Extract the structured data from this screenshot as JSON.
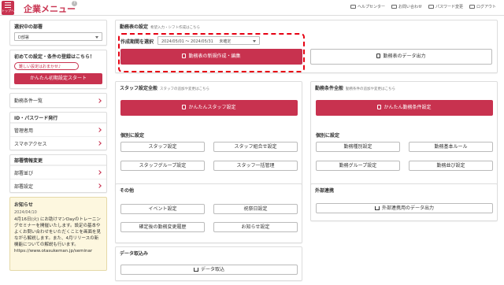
{
  "header": {
    "menu_label": "トップへ",
    "title": "企業メニュー",
    "help_mark": "?",
    "links": [
      {
        "icon": "book-icon",
        "label": "ヘルプセンター"
      },
      {
        "icon": "mail-icon",
        "label": "お問い合わせ"
      },
      {
        "icon": "key-icon",
        "label": "パスワード変更"
      },
      {
        "icon": "logout-icon",
        "label": "ログアウト"
      }
    ]
  },
  "sidebar": {
    "dept_title": "選択中の部署",
    "dept_value": "D部署",
    "setup_title": "初めての設定・条件の登録はこちら！",
    "setup_bubble": "難しい設定はおまかせ♪",
    "setup_button": "かんたん初期設定スタート",
    "work_conditions": "勤務条件一覧",
    "id_password_title": "ID・パスワード発行",
    "id_items": [
      "管理者用",
      "スマホアクセス"
    ],
    "dept_info_title": "部署情報変更",
    "dept_items": [
      "部署並び",
      "部署設定"
    ],
    "notice": {
      "title": "お知らせ",
      "date": "2024/04/10",
      "text": "4月16日(火) にお助けマンDayのトレーニングセミナーを開催いたします。設定の基本やよくお問い合わせをいただくことを画面を見ながら解説します。また、4月リリースの新機能についての解説も行います。",
      "url": "https://www.otasukeman.jp/seminar"
    }
  },
  "schedule": {
    "title": "勤務表の設定",
    "subtitle": "希望入力・シフト作成はこちら",
    "period_label": "作成期間を選択",
    "period_value": "2024/05/01 ～ 2024/05/31",
    "period_status": "未確定",
    "create_button": "勤務表の新規作成・編集",
    "export_button": "勤務表のデータ出力"
  },
  "staff": {
    "title": "スタッフ設定全般",
    "subtitle": "スタッフの追加や変更はこちら",
    "easy_button": "かんたんスタッフ設定",
    "individual_label": "個別に設定",
    "buttons": [
      "スタッフ設定",
      "スタッフ組合せ設定",
      "スタッフグループ設定",
      "スタッフ一括管理"
    ]
  },
  "conditions": {
    "title": "勤務条件全般",
    "subtitle": "勤務条件の追加や変更はこちら",
    "easy_button": "かんたん勤務条件設定",
    "individual_label": "個別に設定",
    "buttons": [
      "勤務種別設定",
      "勤務基本ルール",
      "勤務グループ設定",
      "勤務並び設定"
    ]
  },
  "other": {
    "title": "その他",
    "buttons": [
      "イベント設定",
      "祝祭日設定",
      "確定後の勤務変更履歴",
      "お知らせ設定"
    ]
  },
  "external": {
    "title": "外部連携",
    "button": "外部連携用のデータ出力"
  },
  "data_import": {
    "title": "データ取込み",
    "button": "データ取込"
  },
  "colors": {
    "accent": "#c8324f",
    "highlight": "#e60012"
  }
}
